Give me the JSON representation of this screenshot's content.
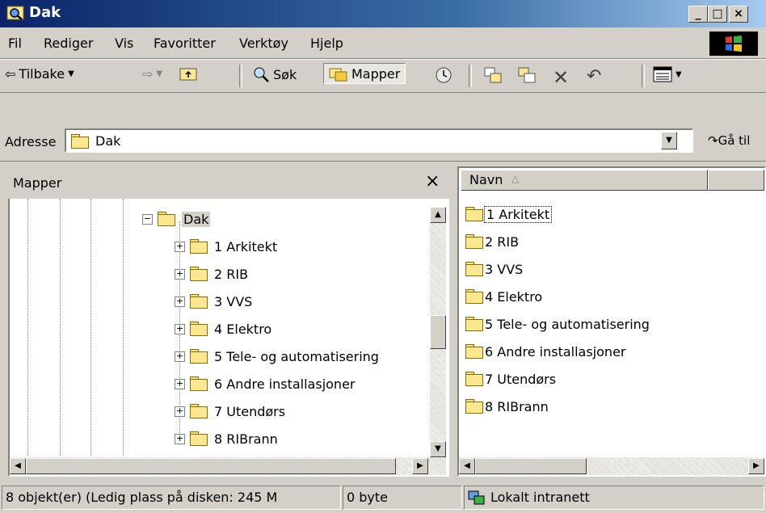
{
  "window": {
    "title": "Dak"
  },
  "menu": {
    "items": [
      "Fil",
      "Rediger",
      "Vis",
      "Favoritter",
      "Verktøy",
      "Hjelp"
    ]
  },
  "toolbar": {
    "back_label": "Tilbake",
    "search_label": "Søk",
    "folders_label": "Mapper"
  },
  "address": {
    "label": "Adresse",
    "value": "Dak",
    "go_label": "Gå til"
  },
  "folders_pane": {
    "title": "Mapper",
    "close_glyph": "×",
    "root": "Dak",
    "items": [
      "1 Arkitekt",
      "2 RIB",
      "3 VVS",
      "4 Elektro",
      "5 Tele- og automatisering",
      "6 Andre installasjoner",
      "7 Utendørs",
      "8 RIBrann"
    ]
  },
  "list_pane": {
    "column_name": "Navn",
    "items": [
      "1 Arkitekt",
      "2 RIB",
      "3 VVS",
      "4 Elektro",
      "5 Tele- og automatisering",
      "6 Andre installasjoner",
      "7 Utendørs",
      "8 RIBrann"
    ],
    "selected_index": 0
  },
  "status": {
    "objects": "8 objekt(er) (Ledig plass på disken: 245 M",
    "size": "0 byte",
    "zone": "Lokalt intranett"
  },
  "colors": {
    "titlebar_start": "#0a246a",
    "titlebar_end": "#a6caf0",
    "face": "#d4d0c8"
  }
}
